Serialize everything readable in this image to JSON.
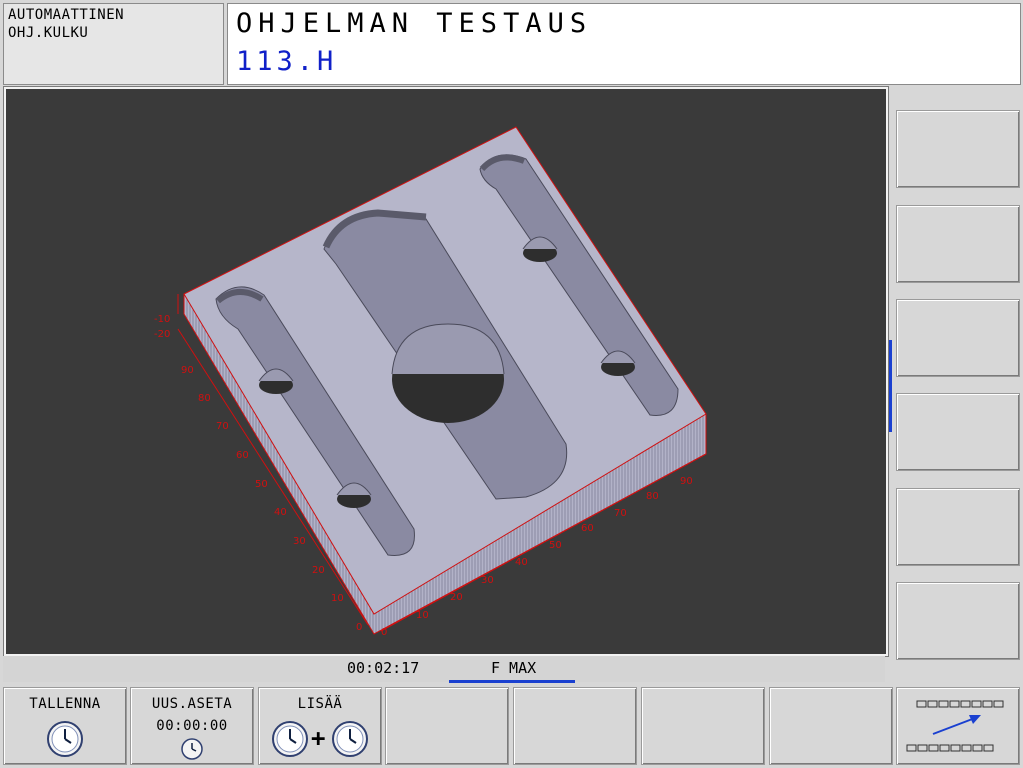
{
  "header": {
    "mode_line1": "AUTOMAATTINEN",
    "mode_line2": "OHJ.KULKU",
    "title": "OHJELMAN TESTAUS",
    "program": "113.H"
  },
  "status": {
    "time": "00:02:17",
    "feed": "F MAX"
  },
  "axis_labels": {
    "z": [
      "-10",
      "-20"
    ],
    "y": [
      "90",
      "80",
      "70",
      "60",
      "50",
      "40",
      "30",
      "20",
      "10",
      "0"
    ],
    "x": [
      "0",
      "10",
      "20",
      "30",
      "40",
      "50",
      "60",
      "70",
      "80",
      "90"
    ]
  },
  "softkeys": {
    "save_label": "TALLENNA",
    "reset_label": "UUS.ASETA",
    "reset_time": "00:00:00",
    "add_label": "LISÄÄ",
    "add_plus": "+"
  },
  "colors": {
    "accent_blue": "#1a40d0",
    "axis_red": "#d01010",
    "background_graphic": "#3a3a3a"
  }
}
